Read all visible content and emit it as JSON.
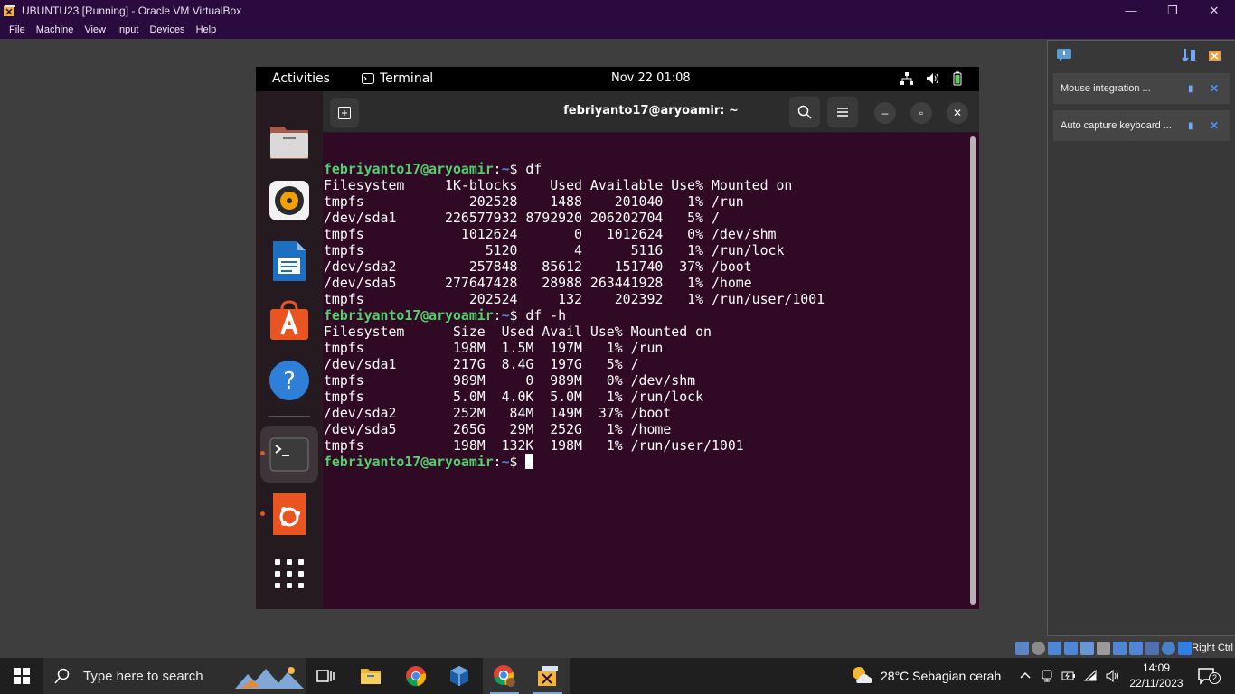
{
  "window": {
    "title": "UBUNTU23 [Running] - Oracle VM VirtualBox"
  },
  "menubar": [
    "File",
    "Machine",
    "View",
    "Input",
    "Devices",
    "Help"
  ],
  "notifications": [
    {
      "text": "Mouse integration ..."
    },
    {
      "text": "Auto capture keyboard ..."
    }
  ],
  "statusbar": {
    "host_key": "Right Ctrl"
  },
  "gnome": {
    "activities": "Activities",
    "app_name": "Terminal",
    "clock": "Nov 22  01:08"
  },
  "dock": [
    {
      "name": "files-icon"
    },
    {
      "name": "rhythmbox-icon"
    },
    {
      "name": "libreoffice-writer-icon"
    },
    {
      "name": "app-center-icon"
    },
    {
      "name": "help-icon"
    },
    {
      "name": "terminal-icon",
      "running": true
    },
    {
      "name": "ubuntu-icon",
      "running": true
    },
    {
      "name": "show-apps-icon"
    }
  ],
  "terminal": {
    "title": "febriyanto17@aryoamir: ~",
    "prompt_user": "febriyanto17@aryoamir",
    "prompt_path": "~",
    "lines": [
      {
        "type": "prompt",
        "cmd": "df"
      },
      {
        "type": "out",
        "text": "Filesystem     1K-blocks    Used Available Use% Mounted on"
      },
      {
        "type": "out",
        "text": "tmpfs             202528    1488    201040   1% /run"
      },
      {
        "type": "out",
        "text": "/dev/sda1      226577932 8792920 206202704   5% /"
      },
      {
        "type": "out",
        "text": "tmpfs            1012624       0   1012624   0% /dev/shm"
      },
      {
        "type": "out",
        "text": "tmpfs               5120       4      5116   1% /run/lock"
      },
      {
        "type": "out",
        "text": "/dev/sda2         257848   85612    151740  37% /boot"
      },
      {
        "type": "out",
        "text": "/dev/sda5      277647428   28988 263441928   1% /home"
      },
      {
        "type": "out",
        "text": "tmpfs             202524     132    202392   1% /run/user/1001"
      },
      {
        "type": "prompt",
        "cmd": "df -h"
      },
      {
        "type": "out",
        "text": "Filesystem      Size  Used Avail Use% Mounted on"
      },
      {
        "type": "out",
        "text": "tmpfs           198M  1.5M  197M   1% /run"
      },
      {
        "type": "out",
        "text": "/dev/sda1       217G  8.4G  197G   5% /"
      },
      {
        "type": "out",
        "text": "tmpfs           989M     0  989M   0% /dev/shm"
      },
      {
        "type": "out",
        "text": "tmpfs           5.0M  4.0K  5.0M   1% /run/lock"
      },
      {
        "type": "out",
        "text": "/dev/sda2       252M   84M  149M  37% /boot"
      },
      {
        "type": "out",
        "text": "/dev/sda5       265G   29M  252G   1% /home"
      },
      {
        "type": "out",
        "text": "tmpfs           198M  132K  198M   1% /run/user/1001"
      },
      {
        "type": "prompt",
        "cmd": "",
        "cursor": true
      }
    ]
  },
  "taskbar": {
    "search_placeholder": "Type here to search",
    "weather": "28°C  Sebagian cerah",
    "time": "14:09",
    "date": "22/11/2023",
    "notification_count": "2"
  }
}
